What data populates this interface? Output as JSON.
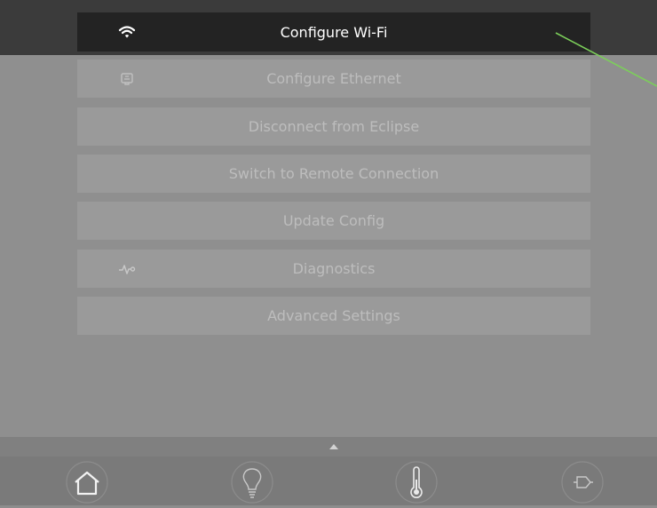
{
  "menu": {
    "items": [
      {
        "label": "Configure Wi-Fi",
        "icon": "wifi-icon",
        "active": true
      },
      {
        "label": "Configure Ethernet",
        "icon": "ethernet-icon",
        "active": false
      },
      {
        "label": "Disconnect from Eclipse",
        "icon": null,
        "active": false
      },
      {
        "label": "Switch to Remote Connection",
        "icon": null,
        "active": false
      },
      {
        "label": "Update Config",
        "icon": null,
        "active": false
      },
      {
        "label": "Diagnostics",
        "icon": "diagnostics-icon",
        "active": false
      },
      {
        "label": "Advanced Settings",
        "icon": null,
        "active": false
      }
    ]
  },
  "bottom_nav": {
    "items": [
      {
        "icon": "home-icon"
      },
      {
        "icon": "lightbulb-icon"
      },
      {
        "icon": "thermometer-icon"
      },
      {
        "icon": "plug-icon"
      }
    ]
  },
  "colors": {
    "active_item_bg": "#232323",
    "item_bg": "#9a9a9a",
    "item_text": "#bdbdbd",
    "active_text": "#ffffff",
    "pointer_line": "#7ccf5a"
  }
}
